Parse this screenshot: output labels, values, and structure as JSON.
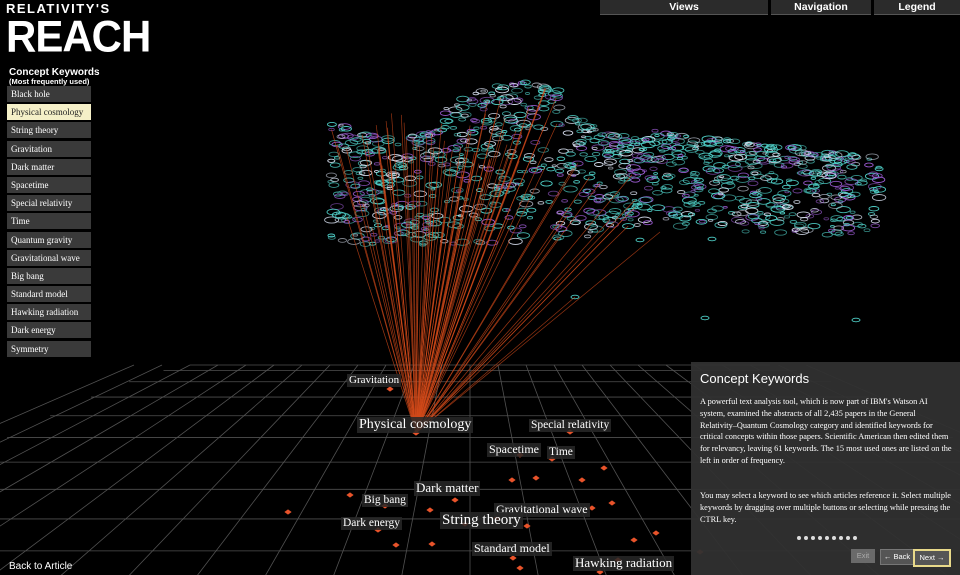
{
  "logo": {
    "top": "RELATIVITY'S",
    "main": "REACH"
  },
  "nav": [
    {
      "label": "Views"
    },
    {
      "label": "Navigation"
    },
    {
      "label": "Legend"
    }
  ],
  "keywords": {
    "title": "Concept Keywords",
    "subtitle": "(Most frequently used)",
    "items": [
      {
        "label": "Black hole"
      },
      {
        "label": "Physical cosmology",
        "active": true
      },
      {
        "label": "String theory"
      },
      {
        "label": "Gravitation"
      },
      {
        "label": "Dark matter"
      },
      {
        "label": "Spacetime"
      },
      {
        "label": "Special relativity"
      },
      {
        "label": "Time"
      },
      {
        "label": "Quantum gravity"
      },
      {
        "label": "Gravitational wave"
      },
      {
        "label": "Big bang"
      },
      {
        "label": "Standard model"
      },
      {
        "label": "Hawking radiation"
      },
      {
        "label": "Dark energy"
      },
      {
        "label": "Symmetry"
      }
    ]
  },
  "back_link": "Back to Article",
  "panel": {
    "title": "Concept Keywords",
    "paragraph1": "A powerful text analysis tool, which is now part of IBM's Watson AI system, examined the abstracts of all 2,435 papers in the General Relativity–Quantum Cosmology category and identified keywords for critical concepts within those papers. Scientific American then edited them for relevancy, leaving 61 keywords. The 15 most used ones are listed on the left in order of frequency.",
    "paragraph2": "You may select a keyword to see which articles reference it. Select multiple keywords by dragging over multiple buttons or selecting while pressing the CTRL key.",
    "page_dots": 9,
    "exit": "Exit",
    "back": "← Back",
    "next": "Next →"
  },
  "grid_labels": [
    {
      "text": "Gravitation"
    },
    {
      "text": "Physical cosmology"
    },
    {
      "text": "Special relativity"
    },
    {
      "text": "Spacetime"
    },
    {
      "text": "Time"
    },
    {
      "text": "Dark matter"
    },
    {
      "text": "Big bang"
    },
    {
      "text": "Gravitational wave"
    },
    {
      "text": "Dark energy"
    },
    {
      "text": "String theory"
    },
    {
      "text": "Standard model"
    },
    {
      "text": "Hawking radiation"
    }
  ],
  "colors": {
    "beam": "#d24a1a",
    "node": "#e8532a",
    "cloud_a": "#4fd0c8",
    "cloud_b": "#9a5ad0",
    "active_button": "#f5f0c8"
  }
}
